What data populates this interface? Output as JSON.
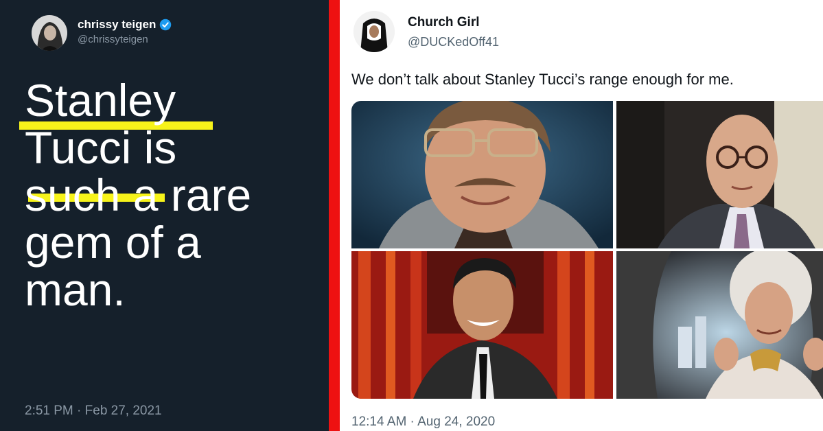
{
  "left_tweet": {
    "display_name": "chrissy teigen",
    "handle": "@chrissyteigen",
    "text_line1": "Stanley",
    "text_line2_word1": "Tucci",
    "text_line2_rest": " is",
    "text_line3": "such a rare",
    "text_line4": "gem of a",
    "text_line5": "man.",
    "timestamp": "2:51 PM · Feb 27, 2021",
    "highlight_color": "#f7f31a",
    "background_color": "#15202b"
  },
  "divider_color": "#ee1111",
  "right_tweet": {
    "display_name": "Church Girl",
    "handle": "@DUCKedOff41",
    "text": "We don’t talk about Stanley Tucci’s range enough for me.",
    "timestamp": "12:14 AM · Aug 24, 2020",
    "photos": [
      "man-with-glasses-and-mustache",
      "bald-man-with-round-glasses",
      "smiling-host-in-suit-on-stage",
      "man-in-white-curly-wig"
    ]
  }
}
